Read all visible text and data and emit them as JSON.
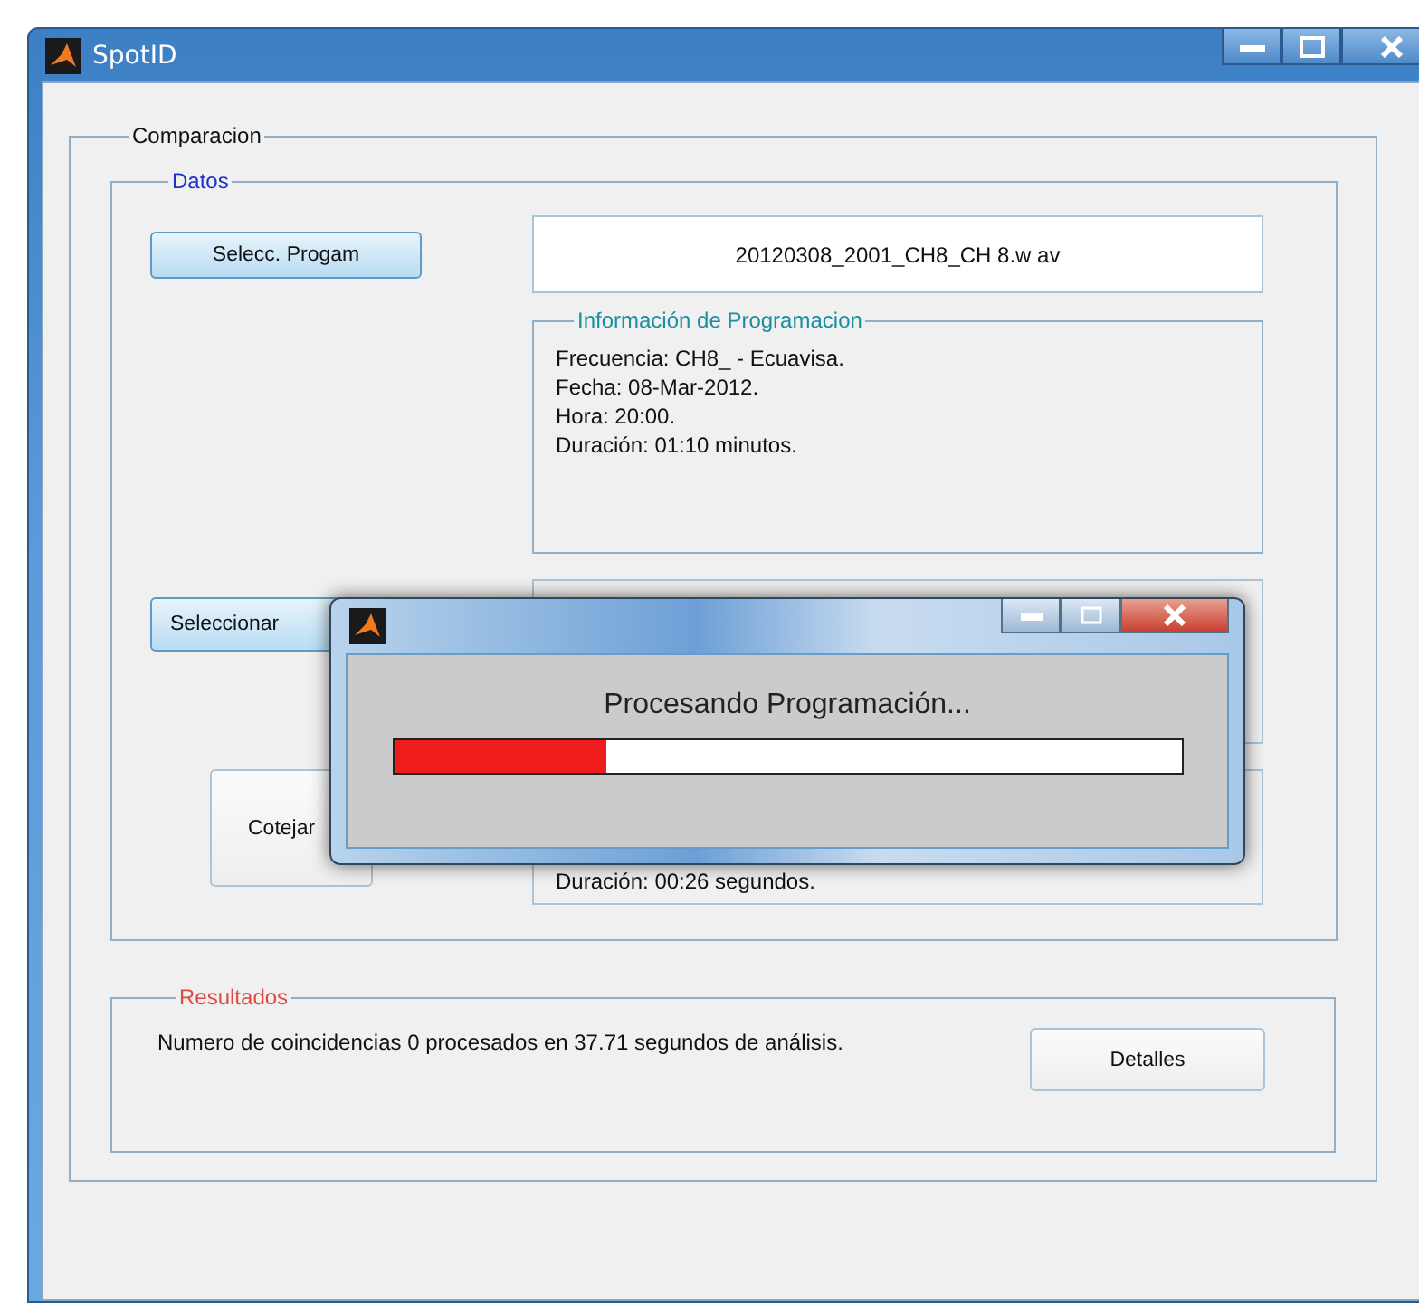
{
  "window": {
    "title": "SpotID"
  },
  "comparacion": {
    "legend": "Comparacion",
    "datos": {
      "legend": "Datos",
      "select_program_button": "Selecc. Progam",
      "file_name": "20120308_2001_CH8_CH 8.w av",
      "program_info": {
        "legend": "Información de Programacion",
        "lines": [
          "Frecuencia: CH8_ - Ecuavisa.",
          "Fecha: 08-Mar-2012.",
          "Hora: 20:00.",
          "Duración: 01:10 minutos."
        ]
      },
      "select_button": "Seleccionar",
      "compare_button": "Cotejar",
      "spot_info": {
        "lines": [
          "Duración: 00:26 segundos."
        ]
      }
    },
    "resultados": {
      "legend": "Resultados",
      "message": "Numero de coincidencias 0 procesados en 37.71 segundos de análisis.",
      "details_button": "Detalles"
    }
  },
  "progress_dialog": {
    "message": "Procesando Programación...",
    "level": 0.27
  }
}
